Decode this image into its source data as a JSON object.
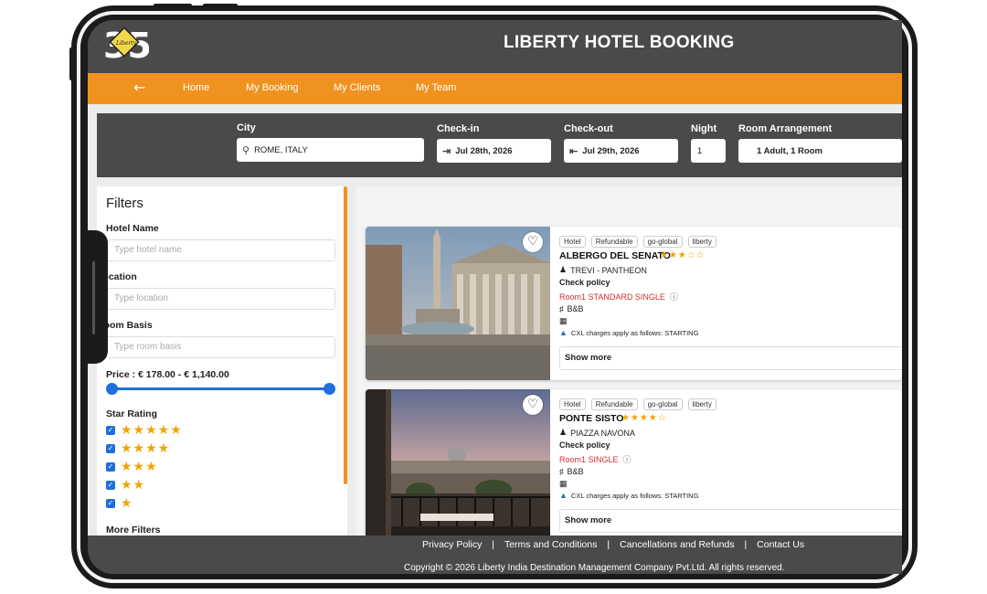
{
  "app": {
    "title": "LIBERTY HOTEL BOOKING",
    "logo_text": "35"
  },
  "nav": {
    "back_icon": "arrow-left-icon",
    "items": [
      {
        "label": "Home"
      },
      {
        "label": "My Booking"
      },
      {
        "label": "My Clients"
      },
      {
        "label": "My Team"
      }
    ]
  },
  "search": {
    "city_label": "City",
    "city_value": "ROME, ITALY",
    "checkin_label": "Check-in",
    "checkin_value": "Jul 28th, 2026",
    "checkout_label": "Check-out",
    "checkout_value": "Jul 29th, 2026",
    "night_label": "Night",
    "night_value": "1",
    "room_label": "Room Arrangement",
    "room_value": "1 Adult, 1 Room"
  },
  "filters": {
    "title": "Filters",
    "hotel_name_label": "Hotel Name",
    "hotel_name_placeholder": "Type hotel name",
    "location_label": "Location",
    "location_placeholder": "Type location",
    "room_basis_label": "Room Basis",
    "room_basis_placeholder": "Type room basis",
    "price_label": "Price : € 178.00 - € 1,140.00",
    "star_rating_label": "Star Rating",
    "star_options": [
      {
        "stars": "★★★★★",
        "checked": true
      },
      {
        "stars": "★★★★",
        "checked": true
      },
      {
        "stars": "★★★",
        "checked": true
      },
      {
        "stars": "★★",
        "checked": true
      },
      {
        "stars": "★",
        "checked": true
      }
    ],
    "more_filters_label": "More Filters"
  },
  "hotels": [
    {
      "tags": [
        "Hotel",
        "Refundable",
        "go-global",
        "liberty"
      ],
      "name": "ALBERGO DEL SENATO",
      "stars": "★★★☆☆",
      "location": "TREVI - PANTHEON",
      "check_policy": "Check policy",
      "room": "Room1 STANDARD SINGLE",
      "basis": "B&B",
      "cxl": "CXL charges apply as follows: STARTING",
      "show_more": "Show more"
    },
    {
      "tags": [
        "Hotel",
        "Refundable",
        "go-global",
        "liberty"
      ],
      "name": "PONTE SISTO",
      "stars": "★★★★☆",
      "location": "PIAZZA NAVONA",
      "check_policy": "Check policy",
      "room": "Room1 SINGLE",
      "basis": "B&B",
      "cxl": "CXL charges apply as follows: STARTING",
      "show_more": "Show more"
    }
  ],
  "footer": {
    "privacy": "Privacy Policy",
    "terms": "Terms and Conditions",
    "cancellations": "Cancellations and Refunds",
    "contact": "Contact Us",
    "separator": "|",
    "copyright": "Copyright © 2026 Liberty India Destination Management Company Pvt.Ltd. All rights reserved."
  },
  "colors": {
    "accent": "#f0921f",
    "header_bg": "#4a4a4a",
    "primary_blue": "#1e6fd9",
    "star": "#f0a400",
    "room_red": "#d32f2f"
  }
}
